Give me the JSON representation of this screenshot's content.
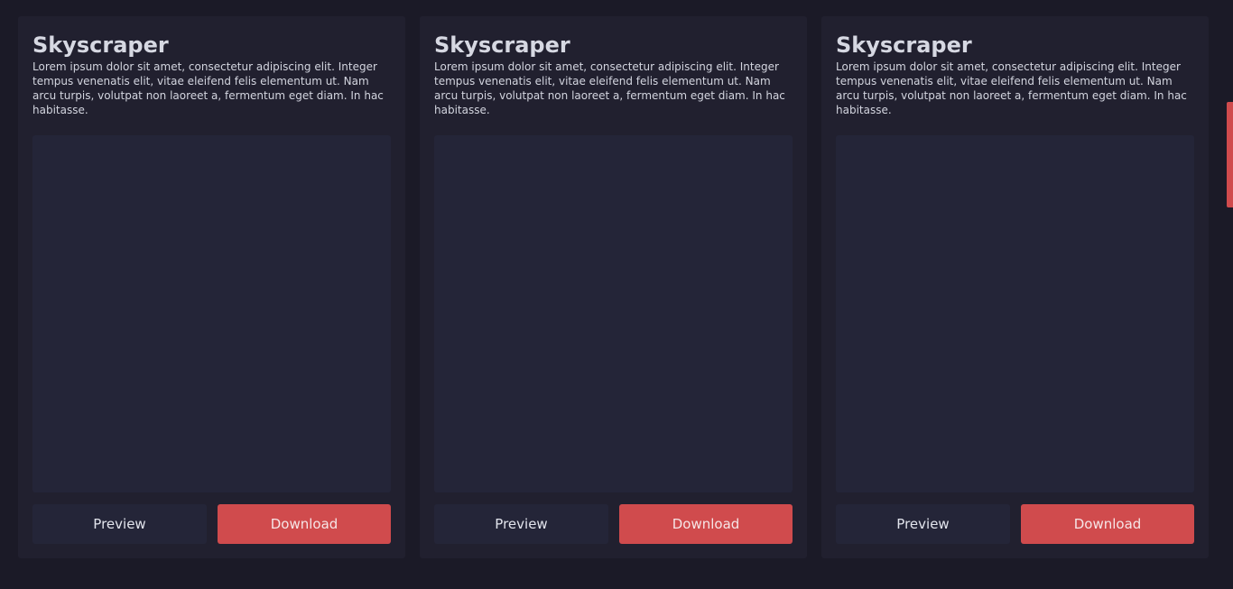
{
  "cards": [
    {
      "title": "Skyscraper",
      "description": "Lorem ipsum dolor sit amet, consectetur adipiscing elit. Integer tempus venenatis elit, vitae eleifend felis elementum ut. Nam arcu turpis, volutpat non laoreet a, fermentum eget diam. In hac habitasse.",
      "preview_label": "Preview",
      "download_label": "Download"
    },
    {
      "title": "Skyscraper",
      "description": "Lorem ipsum dolor sit amet, consectetur adipiscing elit. Integer tempus venenatis elit, vitae eleifend felis elementum ut. Nam arcu turpis, volutpat non laoreet a, fermentum eget diam. In hac habitasse.",
      "preview_label": "Preview",
      "download_label": "Download"
    },
    {
      "title": "Skyscraper",
      "description": "Lorem ipsum dolor sit amet, consectetur adipiscing elit. Integer tempus venenatis elit, vitae eleifend felis elementum ut. Nam arcu turpis, volutpat non laoreet a, fermentum eget diam. In hac habitasse.",
      "preview_label": "Preview",
      "download_label": "Download"
    }
  ],
  "colors": {
    "background": "#1b1a27",
    "card": "#21202f",
    "image_placeholder": "#242538",
    "accent": "#d04b4d"
  }
}
